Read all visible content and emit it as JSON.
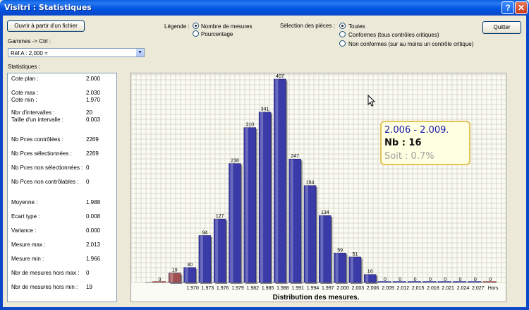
{
  "window": {
    "title": "Visitri : Statistiques",
    "help": "?",
    "close": "✕"
  },
  "buttons": {
    "open_file": "Ouvrir à partir d'un fichier",
    "quit": "Quitter"
  },
  "gammes": {
    "label": "Gammes -> Ctrl :",
    "selected": "Réf A :  2,000 ="
  },
  "legend": {
    "label": "Légende :",
    "options": [
      "Nombre de mesures",
      "Pourcentage"
    ],
    "selected": 0
  },
  "selection": {
    "label": "Sélection des pièces :",
    "options": [
      "Toutes",
      "Conformes (tous contrôles critiques)",
      "Non conformes (sur au moins un contrôle critique)"
    ],
    "selected": 0
  },
  "statistics": {
    "label": "Statistiques :",
    "rows": [
      {
        "label": "Cote plan :",
        "value": "2.000"
      },
      {
        "label": "Cote max :",
        "value": "2.030"
      },
      {
        "label": "Cote min :",
        "value": "1.970"
      },
      {
        "label": "Nbr d'intervalles :",
        "value": "20"
      },
      {
        "label": "Taille d'un intervalle :",
        "value": "0.003"
      },
      {
        "label": "Nb Pces contrôlées :",
        "value": "2269"
      },
      {
        "label": "Nb Pces sélectionnées :",
        "value": "2269"
      },
      {
        "label": "Nb Pces non sélectionnées :",
        "value": "0"
      },
      {
        "label": "Nb Pces non contrôlables :",
        "value": "0"
      },
      {
        "label": "Moyenne :",
        "value": "1.988"
      },
      {
        "label": "Ecart type :",
        "value": "0.008"
      },
      {
        "label": "Variance :",
        "value": "0.000"
      },
      {
        "label": "Mesure max :",
        "value": "2.013"
      },
      {
        "label": "Mesure min :",
        "value": "1.966"
      },
      {
        "label": "Nbr de mesures hors max :",
        "value": "0"
      },
      {
        "label": "Nbr de mesures hors min :",
        "value": "19"
      }
    ]
  },
  "tooltip": {
    "range": "2.006 - 2.009.",
    "count": "Nb : 16",
    "percent": "Soit : 0.7%"
  },
  "colors": {
    "bar": "#3a3aa8",
    "bar_out_of_range": "#a05050",
    "grid": "#d8d8c8"
  },
  "chart_data": {
    "type": "bar",
    "title": "Distribution des mesures.",
    "categories": [
      "",
      "",
      "1.970",
      "1.973",
      "1.976",
      "1.979",
      "1.982",
      "1.985",
      "1.988",
      "1.991",
      "1.994",
      "1.997",
      "2.000",
      "2.003",
      "2.006",
      "2.009",
      "2.012",
      "2.015",
      "2.018",
      "2.021",
      "2.024",
      "2.027",
      "Hors"
    ],
    "values": [
      0,
      19,
      30,
      94,
      127,
      238,
      310,
      341,
      407,
      247,
      194,
      134,
      59,
      51,
      16,
      0,
      0,
      0,
      0,
      0,
      0,
      0,
      0
    ],
    "out_of_range": [
      true,
      true,
      false,
      false,
      false,
      false,
      false,
      false,
      false,
      false,
      false,
      false,
      false,
      false,
      false,
      false,
      false,
      false,
      false,
      false,
      false,
      false,
      true
    ],
    "ylim": [
      0,
      407
    ],
    "grid": true
  }
}
